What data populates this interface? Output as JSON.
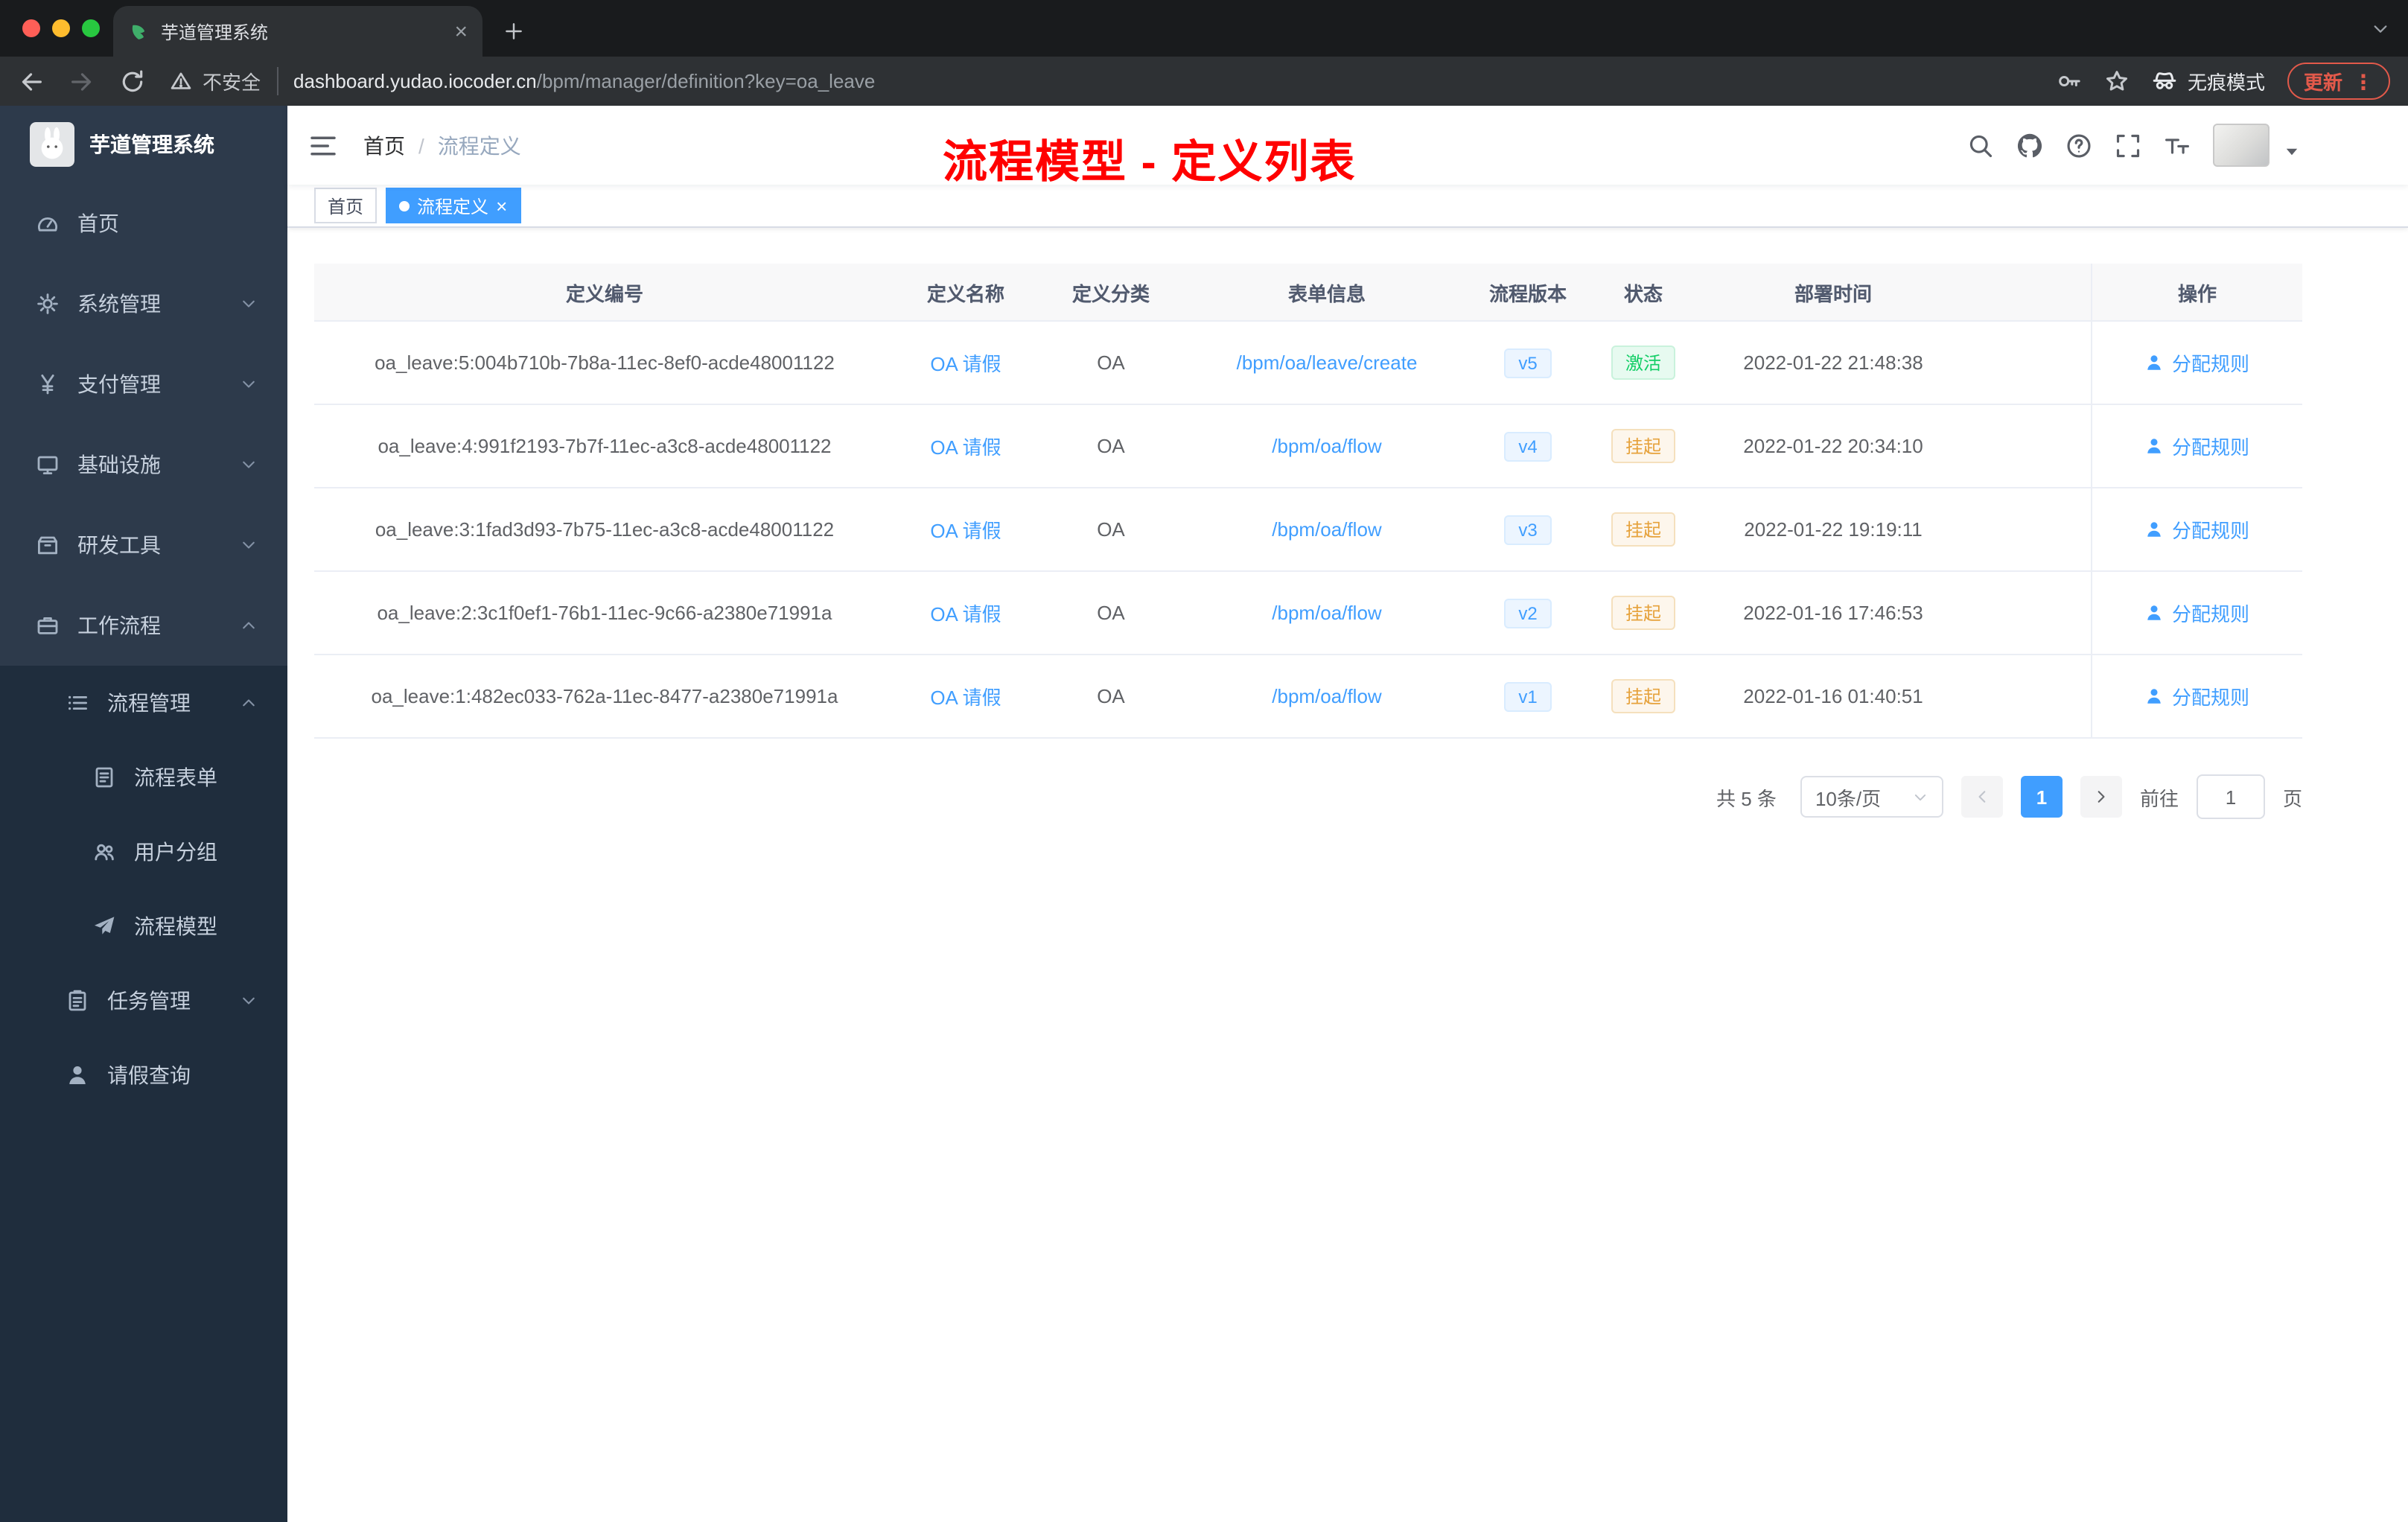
{
  "colors": {
    "accent": "#409eff",
    "annotation_red": "#ff0000",
    "status_active_green": "#13ce66",
    "status_suspended_orange": "#e6a23c",
    "sidebar_bg": "#2d3a4b",
    "sidebar_submenu_bg": "#1f2d3d"
  },
  "browser": {
    "tab_title": "芋道管理系统",
    "security_label": "不安全",
    "url_host": "dashboard.yudao.iocoder.cn",
    "url_path": "/bpm/manager/definition?key=oa_leave",
    "incognito_label": "无痕模式",
    "update_label": "更新"
  },
  "sidebar": {
    "logo_title": "芋道管理系统",
    "items": [
      {
        "key": "home",
        "label": "首页",
        "icon": "dashboard-icon",
        "level": 1,
        "chevron": null,
        "submenu": false
      },
      {
        "key": "system-management",
        "label": "系统管理",
        "icon": "gear-icon",
        "level": 1,
        "chevron": "down",
        "submenu": false
      },
      {
        "key": "payment-management",
        "label": "支付管理",
        "icon": "yen-icon",
        "level": 1,
        "chevron": "down",
        "submenu": false
      },
      {
        "key": "infrastructure",
        "label": "基础设施",
        "icon": "monitor-icon",
        "level": 1,
        "chevron": "down",
        "submenu": false
      },
      {
        "key": "dev-tools",
        "label": "研发工具",
        "icon": "box-icon",
        "level": 1,
        "chevron": "down",
        "submenu": false
      },
      {
        "key": "workflow",
        "label": "工作流程",
        "icon": "briefcase-icon",
        "level": 1,
        "chevron": "up",
        "submenu": false
      },
      {
        "key": "process-management",
        "label": "流程管理",
        "icon": "list-icon",
        "level": 2,
        "chevron": "up",
        "submenu": true
      },
      {
        "key": "process-form",
        "label": "流程表单",
        "icon": "form-icon",
        "level": 3,
        "chevron": null,
        "submenu": true
      },
      {
        "key": "user-group",
        "label": "用户分组",
        "icon": "users-icon",
        "level": 3,
        "chevron": null,
        "submenu": true
      },
      {
        "key": "process-model",
        "label": "流程模型",
        "icon": "plane-icon",
        "level": 3,
        "chevron": null,
        "submenu": true
      },
      {
        "key": "task-management",
        "label": "任务管理",
        "icon": "tasks-icon",
        "level": 2,
        "chevron": "down",
        "submenu": true
      },
      {
        "key": "leave-query",
        "label": "请假查询",
        "icon": "user-icon",
        "level": 2,
        "chevron": null,
        "submenu": true
      }
    ]
  },
  "header": {
    "breadcrumb": [
      "首页",
      "流程定义"
    ],
    "breadcrumb_separator": "/",
    "annotation": "流程模型 - 定义列表"
  },
  "tags": [
    {
      "key": "home",
      "label": "首页",
      "active": false,
      "closable": false
    },
    {
      "key": "process-definition",
      "label": "流程定义",
      "active": true,
      "closable": true
    }
  ],
  "table": {
    "columns": [
      "定义编号",
      "定义名称",
      "定义分类",
      "表单信息",
      "流程版本",
      "状态",
      "部署时间",
      "操作"
    ],
    "rows": [
      {
        "id": "oa_leave:5:004b710b-7b8a-11ec-8ef0-acde48001122",
        "name": "OA 请假",
        "category": "OA",
        "form": "/bpm/oa/leave/create",
        "version": "v5",
        "status": "激活",
        "status_type": "success",
        "deployed_at": "2022-01-22 21:48:38",
        "action": "分配规则"
      },
      {
        "id": "oa_leave:4:991f2193-7b7f-11ec-a3c8-acde48001122",
        "name": "OA 请假",
        "category": "OA",
        "form": "/bpm/oa/flow",
        "version": "v4",
        "status": "挂起",
        "status_type": "warning",
        "deployed_at": "2022-01-22 20:34:10",
        "action": "分配规则"
      },
      {
        "id": "oa_leave:3:1fad3d93-7b75-11ec-a3c8-acde48001122",
        "name": "OA 请假",
        "category": "OA",
        "form": "/bpm/oa/flow",
        "version": "v3",
        "status": "挂起",
        "status_type": "warning",
        "deployed_at": "2022-01-22 19:19:11",
        "action": "分配规则"
      },
      {
        "id": "oa_leave:2:3c1f0ef1-76b1-11ec-9c66-a2380e71991a",
        "name": "OA 请假",
        "category": "OA",
        "form": "/bpm/oa/flow",
        "version": "v2",
        "status": "挂起",
        "status_type": "warning",
        "deployed_at": "2022-01-16 17:46:53",
        "action": "分配规则"
      },
      {
        "id": "oa_leave:1:482ec033-762a-11ec-8477-a2380e71991a",
        "name": "OA 请假",
        "category": "OA",
        "form": "/bpm/oa/flow",
        "version": "v1",
        "status": "挂起",
        "status_type": "warning",
        "deployed_at": "2022-01-16 01:40:51",
        "action": "分配规则"
      }
    ]
  },
  "pagination": {
    "total": "共 5 条",
    "page_size": "10条/页",
    "current_page": "1",
    "goto_label": "前往",
    "goto_value": "1",
    "page_unit": "页"
  },
  "icons": {
    "search-icon": "magnifier",
    "github-icon": "github mark",
    "question-icon": "? in circle",
    "fullscreen-icon": "corner brackets",
    "fontsize-icon": "Tt resize",
    "hamburger-icon": "menu lines",
    "close-icon": "×",
    "plus-icon": "+",
    "chevron-down-icon": "v",
    "chevron-up-icon": "^",
    "warning-icon": "! triangle",
    "key-icon": "key",
    "star-icon": "bookmark star",
    "incognito-icon": "spy",
    "user-icon": "person",
    "dots-icon": "⋮"
  }
}
